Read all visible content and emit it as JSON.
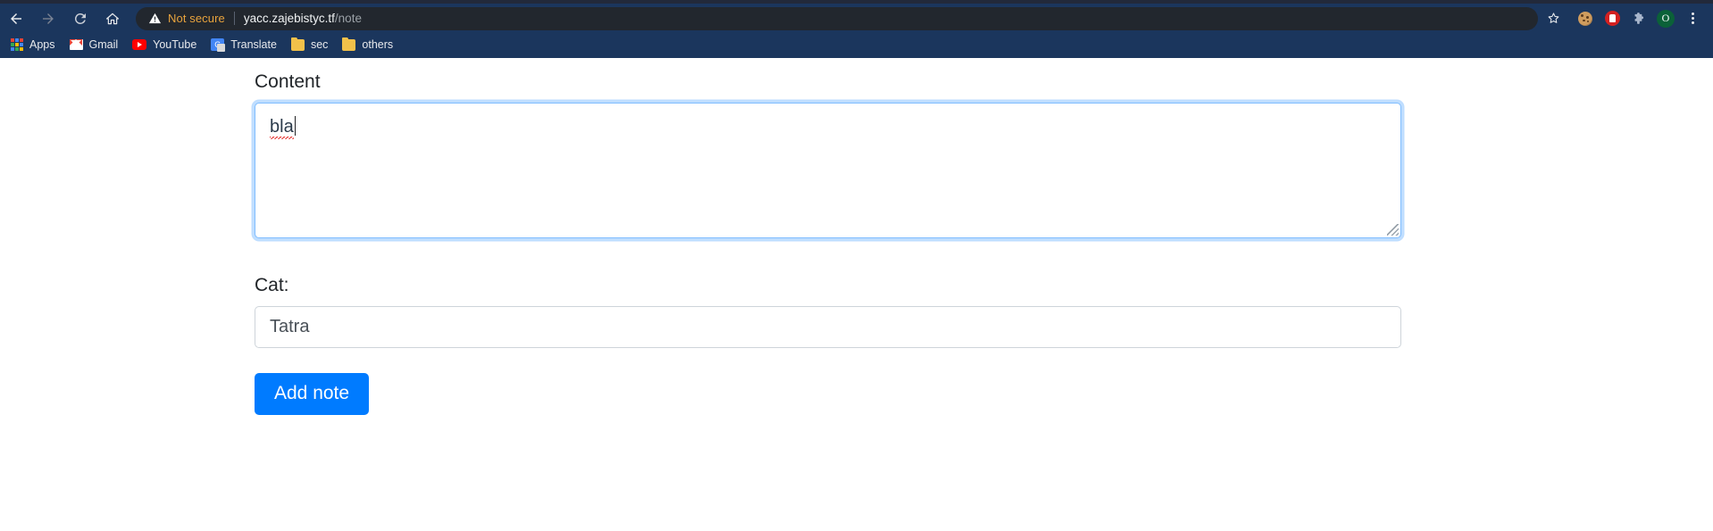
{
  "browser": {
    "nav": {
      "back_icon": "arrow-left-icon",
      "forward_icon": "arrow-right-icon",
      "reload_icon": "reload-icon",
      "home_icon": "home-icon"
    },
    "omnibox": {
      "security_icon": "warning-triangle-icon",
      "security_label": "Not secure",
      "url_host": "yacc.zajebistyc.tf",
      "url_path": "/note",
      "full_url": "yacc.zajebistyc.tf/note"
    },
    "toolbar_right": {
      "bookmark_icon": "star-icon",
      "cookie_icon": "cookie-icon",
      "ublock_icon": "ublock-stop-hand-icon",
      "extensions_icon": "puzzle-piece-icon",
      "profile_initial": "O",
      "menu_icon": "three-dot-menu-icon"
    },
    "bookmarks": [
      {
        "label": "Apps",
        "icon": "apps-grid-icon"
      },
      {
        "label": "Gmail",
        "icon": "gmail-icon"
      },
      {
        "label": "YouTube",
        "icon": "youtube-icon"
      },
      {
        "label": "Translate",
        "icon": "translate-icon"
      },
      {
        "label": "sec",
        "icon": "folder-icon"
      },
      {
        "label": "others",
        "icon": "folder-icon"
      }
    ],
    "colors": {
      "chrome_bg": "#1b365d",
      "omnibox_bg": "#22272e",
      "security_text": "#e8a33d"
    }
  },
  "page": {
    "content_field": {
      "label": "Content",
      "value": "bla",
      "focused": true,
      "misspelled": true
    },
    "cat_field": {
      "label": "Cat:",
      "value": "Tatra",
      "placeholder": "Tatra"
    },
    "submit": {
      "label": "Add note",
      "color": "#007bff"
    }
  }
}
